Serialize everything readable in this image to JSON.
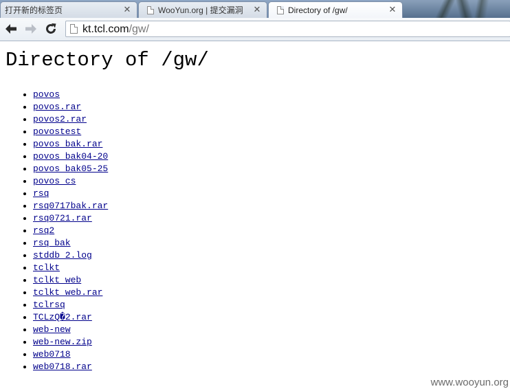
{
  "tabs": [
    {
      "title": "打开新的标签页",
      "active": false
    },
    {
      "title": "WooYun.org | 提交漏洞",
      "active": false
    },
    {
      "title": "Directory of /gw/",
      "active": true
    }
  ],
  "toolbar": {
    "back_icon": "back-arrow-icon",
    "forward_icon": "forward-arrow-icon",
    "reload_icon": "reload-icon",
    "url_host": "kt.tcl.com",
    "url_path": "/gw/"
  },
  "page": {
    "heading": "Directory of /gw/",
    "files": [
      "povos",
      "povos.rar",
      "povos2.rar",
      "povostest",
      "povos_bak.rar",
      "povos_bak04-20",
      "povos_bak05-25",
      "povos_cs",
      "rsq",
      "rsq0717bak.rar",
      "rsq0721.rar",
      "rsq2",
      "rsq_bak",
      "stddb_2.log",
      "tclkt",
      "tclkt_web",
      "tclkt_web.rar",
      "tclrsq",
      "TCLzQ�2.rar",
      "web-new",
      "web-new.zip",
      "web0718",
      "web0718.rar"
    ]
  },
  "watermark": "www.wooyun.org",
  "colors": {
    "link": "#00008b",
    "tabstrip": "#6e8cb3"
  }
}
